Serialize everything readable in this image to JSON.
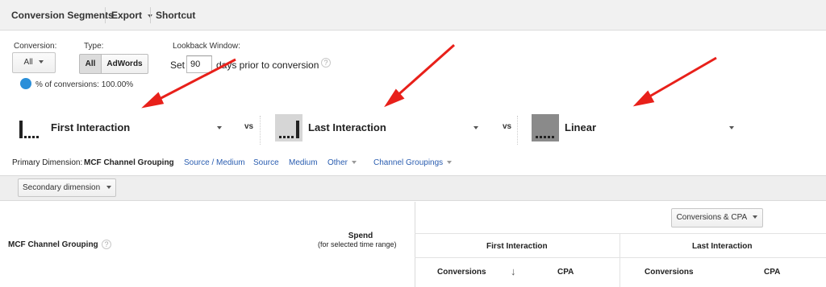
{
  "toolbar": {
    "conversion_segments": "Conversion Segments",
    "export": "Export",
    "shortcut": "Shortcut"
  },
  "controls": {
    "conversion_label": "Conversion:",
    "conversion_value": "All",
    "type_label": "Type:",
    "type_all": "All",
    "type_adwords": "AdWords",
    "lookback_label": "Lookback Window:",
    "lookback_set": "Set",
    "lookback_days": "90",
    "lookback_suffix": "days prior to conversion",
    "help_glyph": "?",
    "pct_conversions": "% of conversions: 100.00%"
  },
  "models": [
    {
      "label": "First Interaction",
      "icon": "first-interaction-icon"
    },
    {
      "label": "Last Interaction",
      "icon": "last-interaction-icon"
    },
    {
      "label": "Linear",
      "icon": "linear-icon"
    }
  ],
  "vs_label": "vs",
  "dimensions": {
    "primary_label": "Primary Dimension:",
    "active": "MCF Channel Grouping",
    "links": [
      "Source / Medium",
      "Source",
      "Medium"
    ],
    "other": "Other",
    "channel_groupings": "Channel Groupings"
  },
  "secondary_dimension": "Secondary dimension",
  "table": {
    "col_main": "MCF Channel Grouping",
    "spend": "Spend",
    "spend_sub": "(for selected time range)",
    "metric_select": "Conversions & CPA",
    "first_interaction": "First Interaction",
    "last_interaction": "Last Interaction",
    "conversions": "Conversions",
    "cpa": "CPA",
    "sort_arrow": "↓"
  },
  "colors": {
    "link": "#2a5db0",
    "arrow": "#e8201a",
    "pie": "#2a8fd9"
  }
}
